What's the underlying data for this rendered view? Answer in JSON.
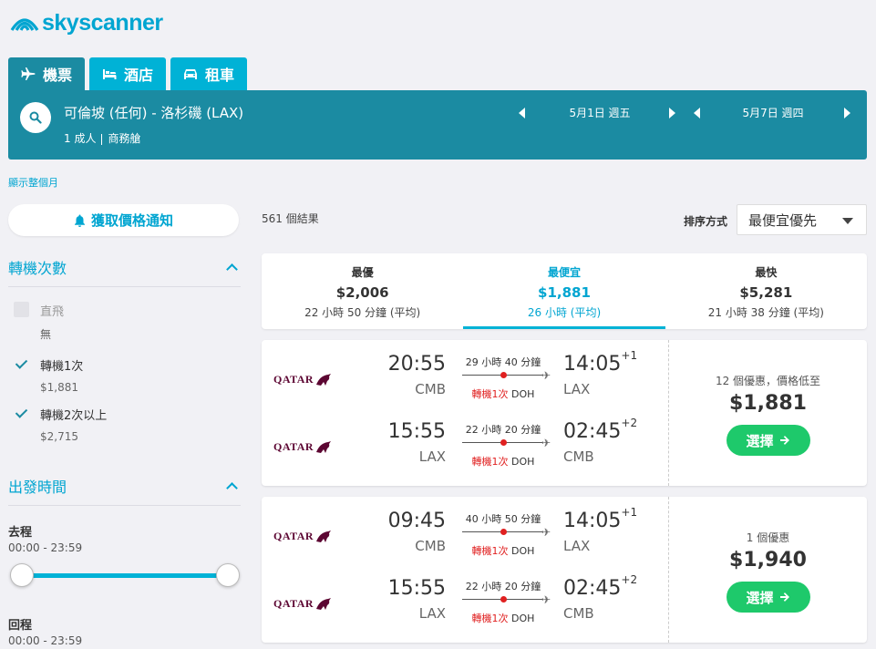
{
  "brand": {
    "name": "skyscanner",
    "color": "#00a5d1"
  },
  "tabs": [
    {
      "label": "機票",
      "icon": "plane-icon",
      "active": true
    },
    {
      "label": "酒店",
      "icon": "bed-icon",
      "active": false
    },
    {
      "label": "租車",
      "icon": "car-icon",
      "active": false
    }
  ],
  "search": {
    "route": "可倫坡 (任何) - 洛杉磯 (LAX)",
    "passengers": "1 成人",
    "cabin": "商務艙",
    "depart_date": "5月1日 週五",
    "return_date": "5月7日 週四"
  },
  "month_link": "顯示整個月",
  "alert_button": "獲取價格通知",
  "filters": {
    "stops": {
      "title": "轉機次數",
      "options": [
        {
          "label": "直飛",
          "price": "無",
          "checked": false,
          "disabled": true
        },
        {
          "label": "轉機1次",
          "price": "$1,881",
          "checked": true,
          "disabled": false
        },
        {
          "label": "轉機2次以上",
          "price": "$2,715",
          "checked": true,
          "disabled": false
        }
      ]
    },
    "departure_time": {
      "title": "出發時間",
      "outbound_label": "去程",
      "outbound_range": "00:00 - 23:59",
      "return_label": "回程",
      "return_range": "00:00 - 23:59"
    }
  },
  "results": {
    "count": "561 個結果",
    "sort_label": "排序方式",
    "sort_value": "最便宜優先"
  },
  "summary": [
    {
      "title": "最優",
      "price": "$2,006",
      "duration": "22 小時 50 分鐘 (平均)",
      "active": false
    },
    {
      "title": "最便宜",
      "price": "$1,881",
      "duration": "26 小時 (平均)",
      "active": true
    },
    {
      "title": "最快",
      "price": "$5,281",
      "duration": "21 小時 38 分鐘 (平均)",
      "active": false
    }
  ],
  "cards": [
    {
      "legs": [
        {
          "airline": "QATAR",
          "dep_time": "20:55",
          "dep_code": "CMB",
          "duration": "29 小時 40 分鐘",
          "stops": "轉機1次",
          "via": "DOH",
          "arr_time": "14:05",
          "arr_offset": "+1",
          "arr_code": "LAX"
        },
        {
          "airline": "QATAR",
          "dep_time": "15:55",
          "dep_code": "LAX",
          "duration": "22 小時 20 分鐘",
          "stops": "轉機1次",
          "via": "DOH",
          "arr_time": "02:45",
          "arr_offset": "+2",
          "arr_code": "CMB"
        }
      ],
      "offers": "12 個優惠，價格低至",
      "price": "$1,881",
      "button": "選擇"
    },
    {
      "legs": [
        {
          "airline": "QATAR",
          "dep_time": "09:45",
          "dep_code": "CMB",
          "duration": "40 小時 50 分鐘",
          "stops": "轉機1次",
          "via": "DOH",
          "arr_time": "14:05",
          "arr_offset": "+1",
          "arr_code": "LAX"
        },
        {
          "airline": "QATAR",
          "dep_time": "15:55",
          "dep_code": "LAX",
          "duration": "22 小時 20 分鐘",
          "stops": "轉機1次",
          "via": "DOH",
          "arr_time": "02:45",
          "arr_offset": "+2",
          "arr_code": "CMB"
        }
      ],
      "offers": "1 個優惠",
      "price": "$1,940",
      "button": "選擇"
    }
  ]
}
